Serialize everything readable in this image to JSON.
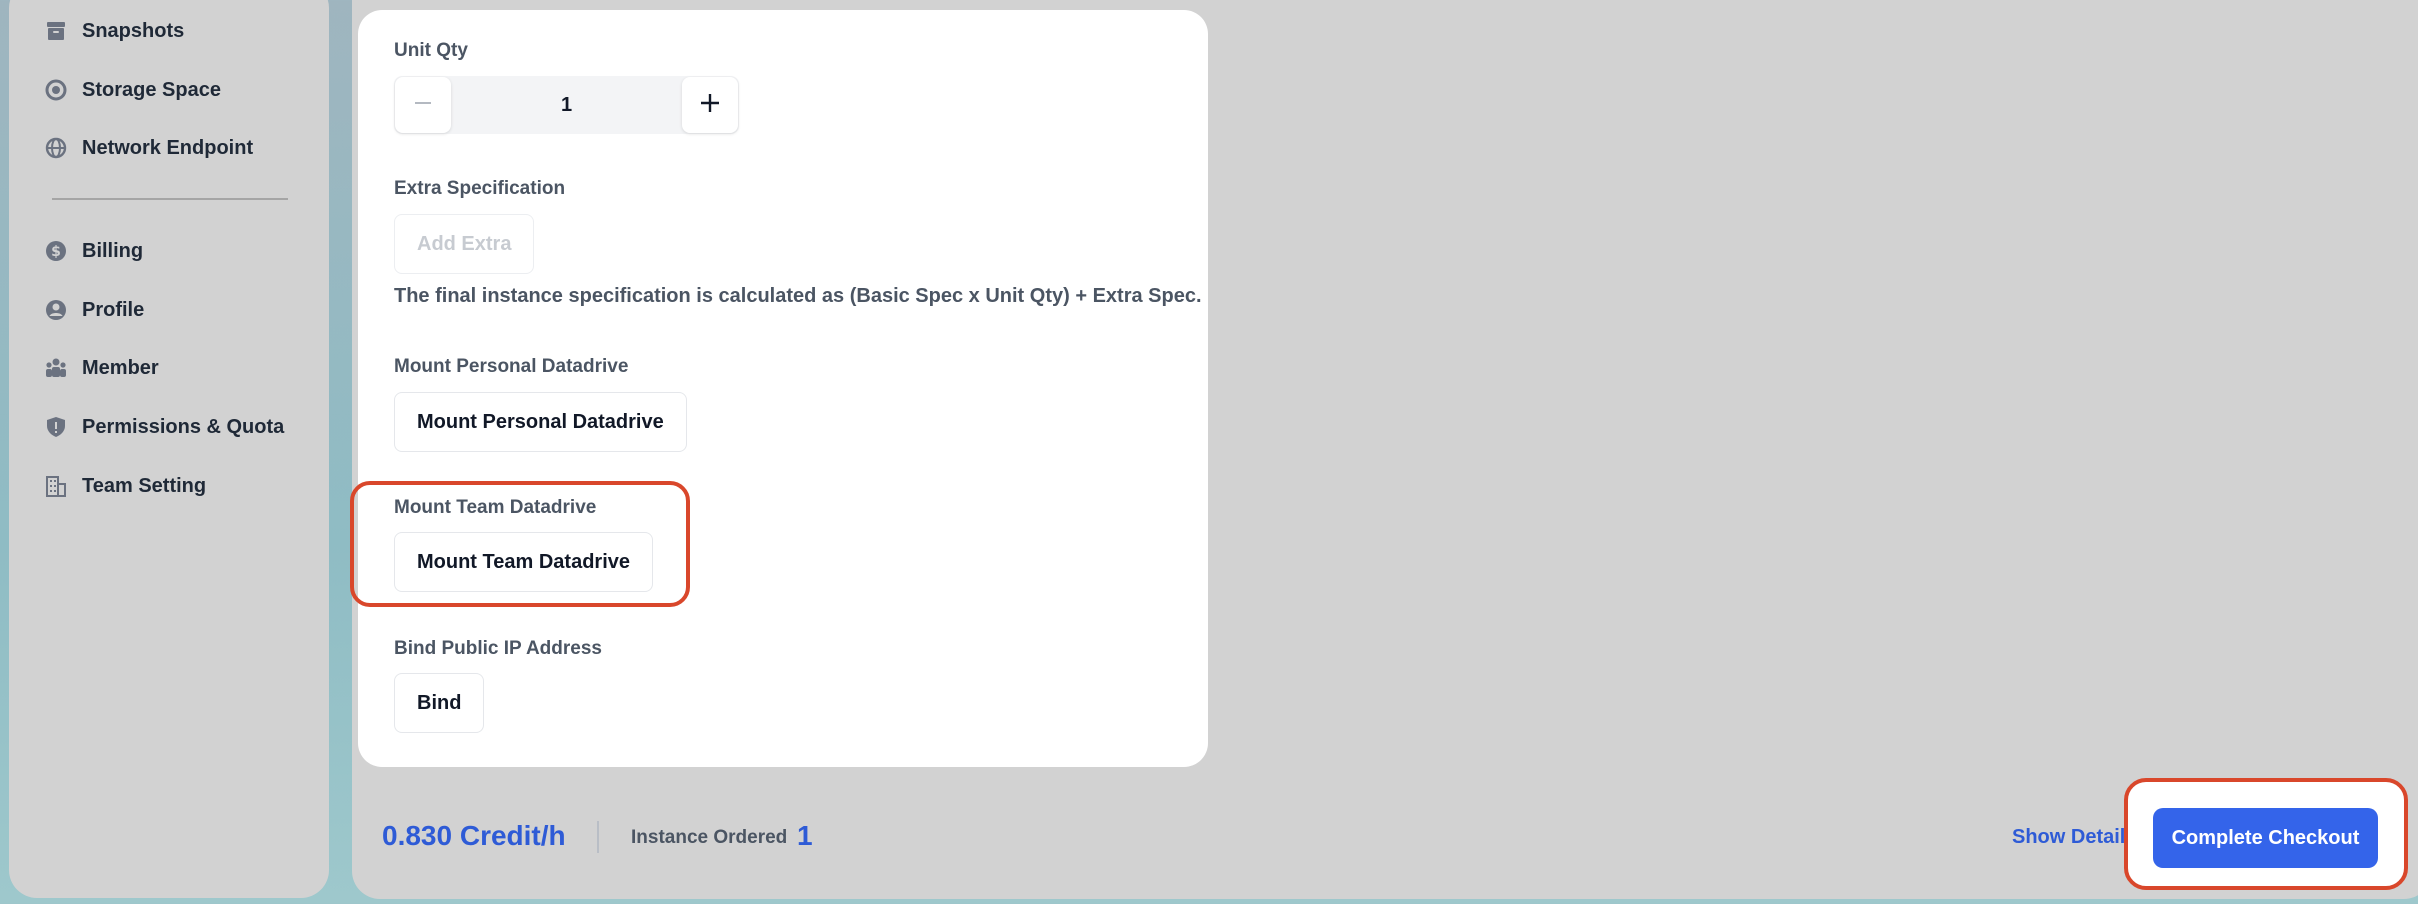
{
  "sidebar": {
    "items": [
      {
        "label": "Snapshots",
        "icon": "archive-icon"
      },
      {
        "label": "Storage Space",
        "icon": "storage-icon"
      },
      {
        "label": "Network Endpoint",
        "icon": "globe-icon"
      },
      {
        "label": "Billing",
        "icon": "dollar-icon"
      },
      {
        "label": "Profile",
        "icon": "user-circle-icon"
      },
      {
        "label": "Member",
        "icon": "members-icon"
      },
      {
        "label": "Permissions & Quota",
        "icon": "shield-icon"
      },
      {
        "label": "Team Setting",
        "icon": "building-icon"
      }
    ]
  },
  "form": {
    "unit_qty_label": "Unit Qty",
    "unit_qty_value": "1",
    "extra_spec_label": "Extra Specification",
    "add_extra_label": "Add Extra",
    "spec_hint": "The final instance specification is calculated as (Basic Spec x Unit Qty) + Extra Spec.",
    "personal_drive_label": "Mount Personal Datadrive",
    "personal_drive_button": "Mount Personal Datadrive",
    "team_drive_label": "Mount Team Datadrive",
    "team_drive_button": "Mount Team Datadrive",
    "public_ip_label": "Bind Public IP Address",
    "bind_button": "Bind"
  },
  "footer": {
    "price": "0.830 Credit/h",
    "instance_ordered_label": "Instance Ordered",
    "instance_ordered_count": "1",
    "show_detail": "Show Detail",
    "checkout": "Complete Checkout"
  },
  "colors": {
    "accent": "#3464ea",
    "highlight": "#d9472b",
    "panel": "#d2d2d2"
  }
}
